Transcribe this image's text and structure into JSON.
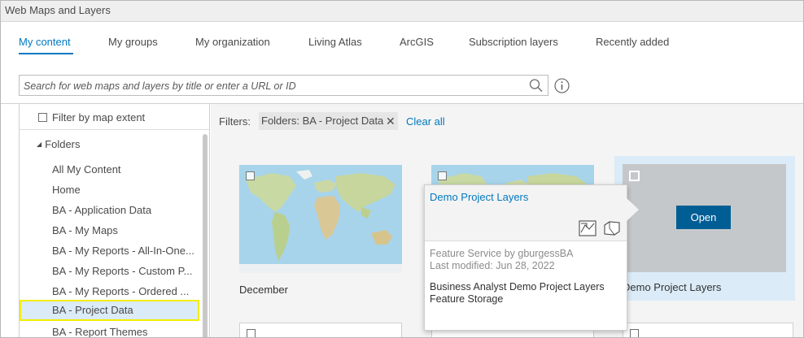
{
  "window": {
    "title": "Web Maps and Layers"
  },
  "tabs": [
    {
      "label": "My content",
      "active": true
    },
    {
      "label": "My groups"
    },
    {
      "label": "My organization"
    },
    {
      "label": "Living Atlas"
    },
    {
      "label": "ArcGIS"
    },
    {
      "label": "Subscription layers"
    },
    {
      "label": "Recently added"
    }
  ],
  "search": {
    "placeholder": "Search for web maps and layers by title or enter a URL or ID",
    "icon": "search-icon",
    "info_icon": "info-icon"
  },
  "sidebar": {
    "filter_by_extent_label": "Filter by map extent",
    "folders_label": "Folders",
    "folders": [
      {
        "label": "All My Content"
      },
      {
        "label": "Home"
      },
      {
        "label": "BA - Application Data"
      },
      {
        "label": "BA - My Maps"
      },
      {
        "label": "BA - My Reports - All-In-One..."
      },
      {
        "label": "BA - My Reports - Custom P..."
      },
      {
        "label": "BA - My Reports - Ordered ..."
      },
      {
        "label": "BA - Project Data",
        "selected": true
      },
      {
        "label": "BA - Report Themes"
      }
    ]
  },
  "main": {
    "filters_label": "Filters:",
    "active_filter_chip": "Folders: BA - Project Data",
    "chip_remove_glyph": "✕",
    "clear_all_label": "Clear all",
    "cards": [
      {
        "title": "December"
      },
      {
        "title": ""
      },
      {
        "title": "Demo Project Layers",
        "selected": true,
        "open_label": "Open"
      }
    ],
    "popover": {
      "title": "Demo Project Layers",
      "meta_owner": "Feature Service by gburgessBA",
      "meta_modified": "Last modified: Jun 28, 2022",
      "description_line1": "Business Analyst Demo Project Layers",
      "description_line2": "Feature Storage"
    }
  },
  "colors": {
    "accent": "#0079c1",
    "open_button": "#005e95",
    "selected_background": "#dbebf7",
    "highlight_outline": "#f2ee00"
  }
}
